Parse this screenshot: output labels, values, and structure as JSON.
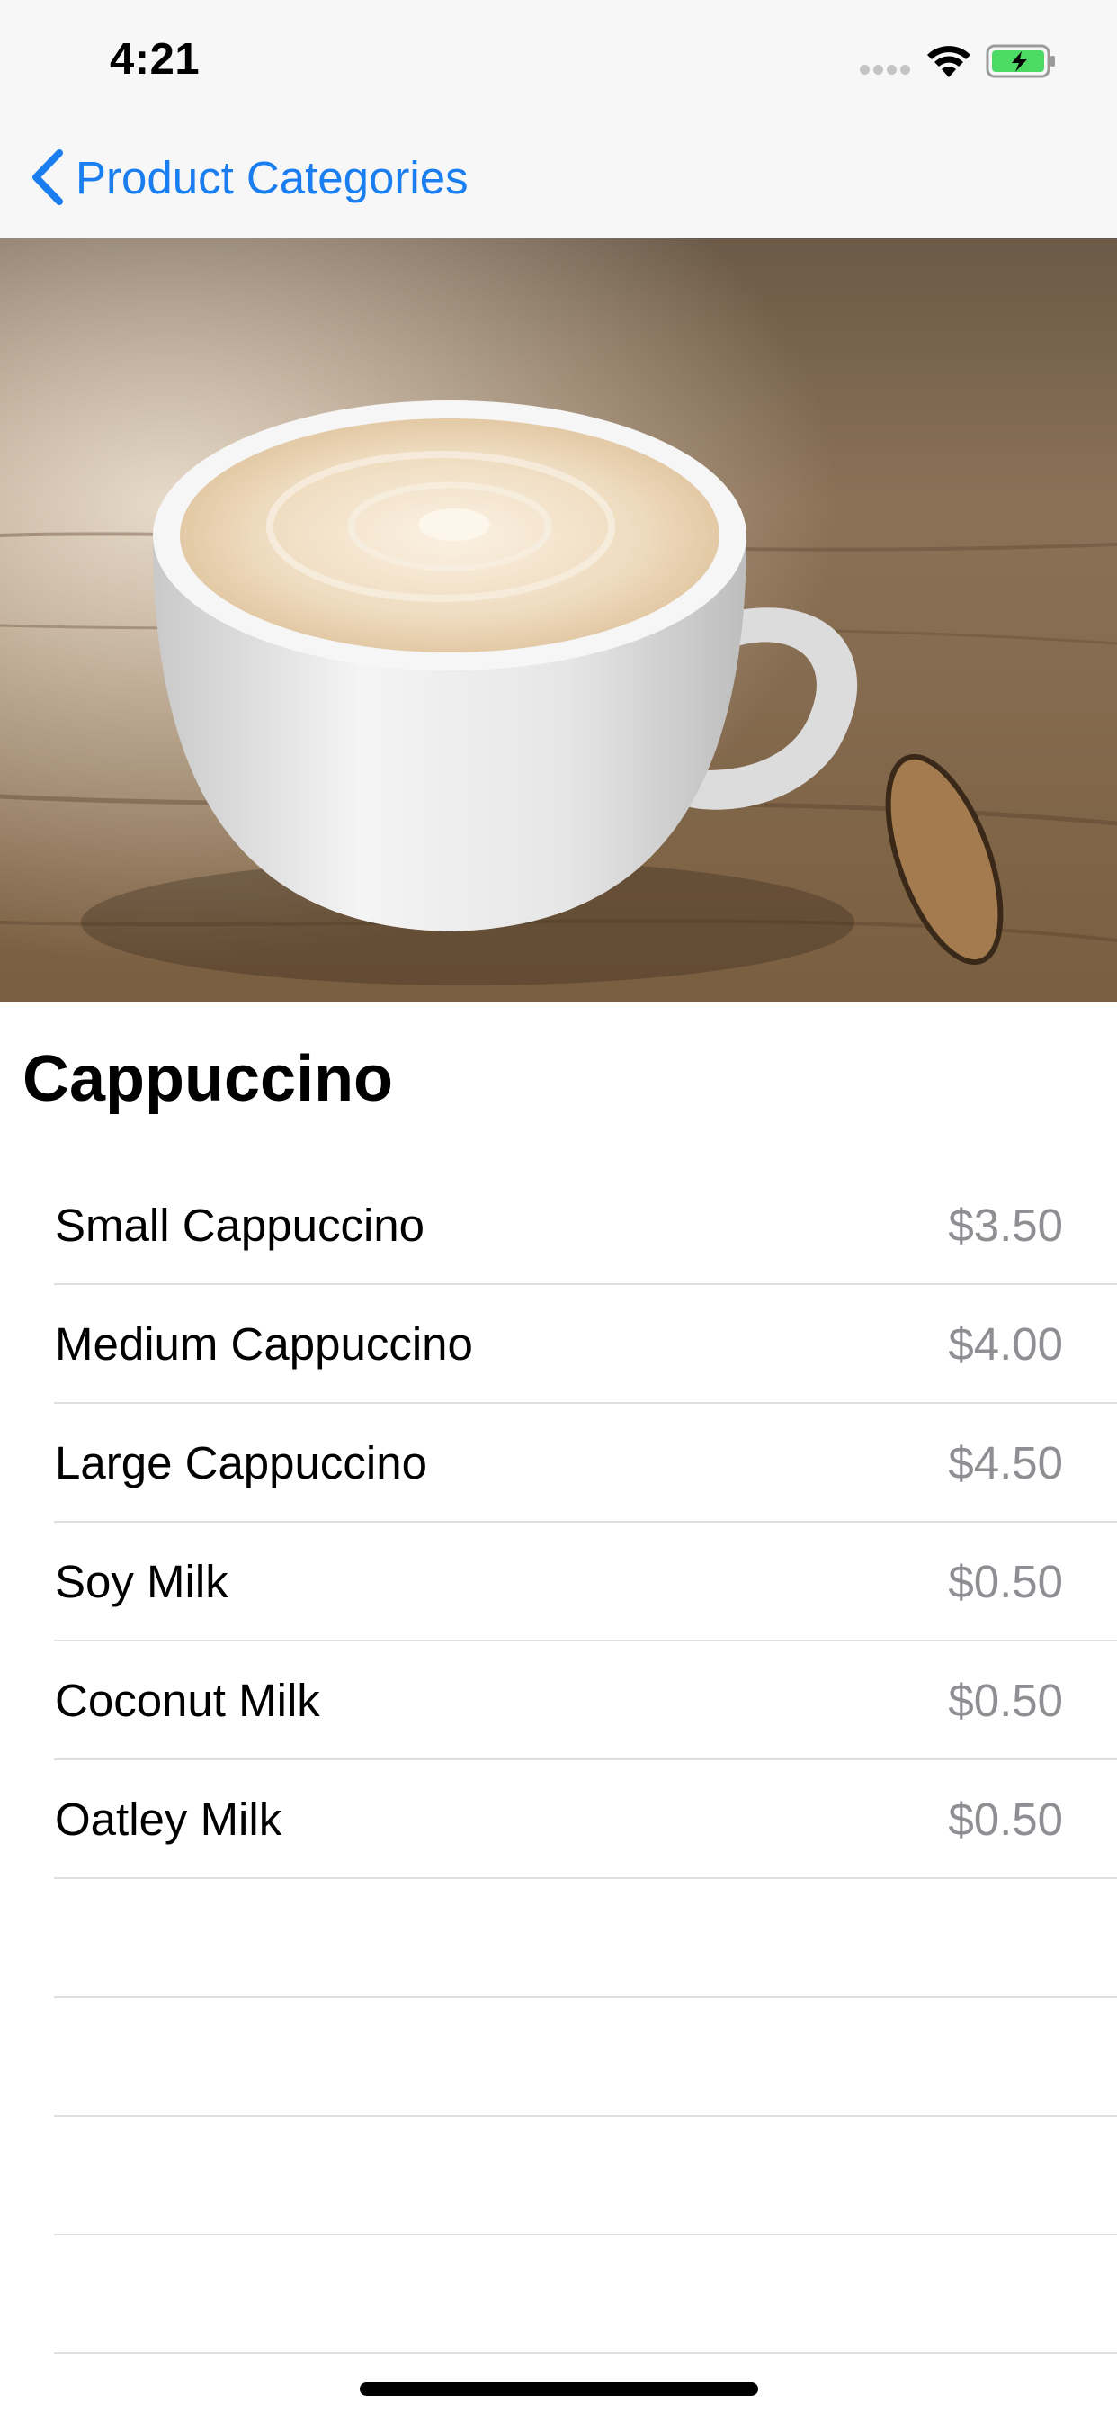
{
  "status_bar": {
    "time": "4:21",
    "wifi_icon": "wifi-icon",
    "battery_icon": "battery-charging-icon",
    "battery_color": "#4cd964"
  },
  "nav": {
    "back_label": "Product Categories",
    "back_icon": "chevron-left-icon",
    "accent_color": "#1a7ef0"
  },
  "hero": {
    "image": "cappuccino-cup-photo"
  },
  "product": {
    "title": "Cappuccino",
    "options": [
      {
        "name": "Small Cappuccino",
        "price": "$3.50"
      },
      {
        "name": "Medium Cappuccino",
        "price": "$4.00"
      },
      {
        "name": "Large Cappuccino",
        "price": "$4.50"
      },
      {
        "name": "Soy Milk",
        "price": "$0.50"
      },
      {
        "name": "Coconut Milk",
        "price": "$0.50"
      },
      {
        "name": "Oatley Milk",
        "price": "$0.50"
      }
    ]
  }
}
